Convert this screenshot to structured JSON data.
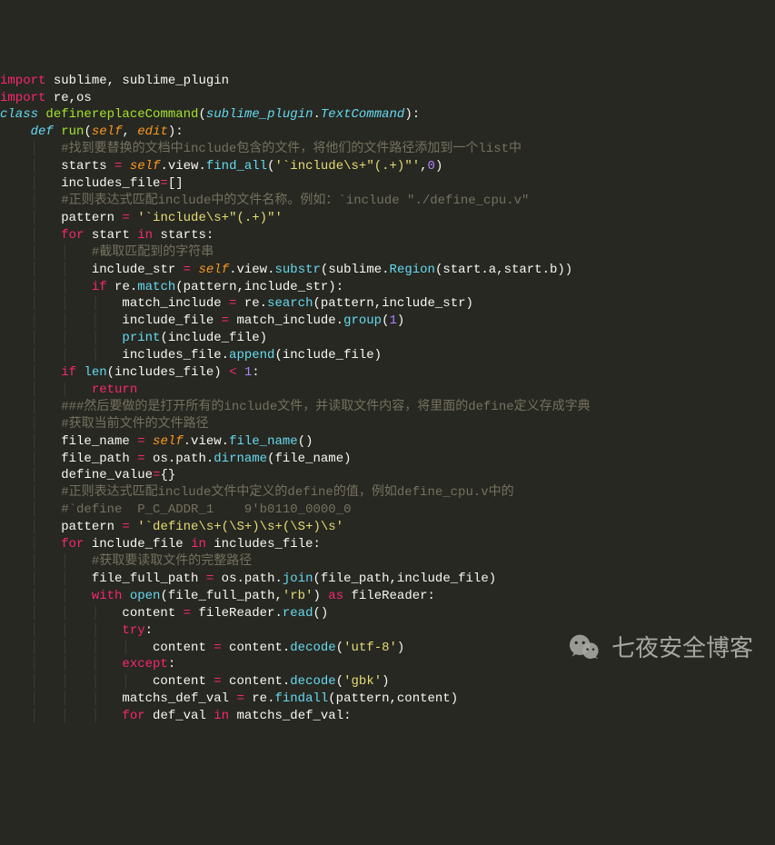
{
  "lines": [
    [
      [
        "kw-import",
        "import"
      ],
      [
        "plain",
        " sublime, sublime_plugin"
      ]
    ],
    [
      [
        "kw-import",
        "import"
      ],
      [
        "plain",
        " re,os"
      ]
    ],
    [
      [
        "plain",
        ""
      ]
    ],
    [
      [
        "kw-class",
        "class"
      ],
      [
        "plain",
        " "
      ],
      [
        "cls-name",
        "definereplaceCommand"
      ],
      [
        "plain",
        "("
      ],
      [
        "type",
        "sublime_plugin"
      ],
      [
        "plain",
        "."
      ],
      [
        "type",
        "TextCommand"
      ],
      [
        "plain",
        "):"
      ]
    ],
    [
      [
        "plain",
        "    "
      ],
      [
        "kw-def",
        "def"
      ],
      [
        "plain",
        " "
      ],
      [
        "fn-name",
        "run"
      ],
      [
        "plain",
        "("
      ],
      [
        "param",
        "self"
      ],
      [
        "plain",
        ", "
      ],
      [
        "param",
        "edit"
      ],
      [
        "plain",
        "):"
      ]
    ],
    [
      [
        "guide",
        "    │   "
      ],
      [
        "comment",
        "#找到要替换的文档中include包含的文件，将他们的文件路径添加到一个list中"
      ]
    ],
    [
      [
        "guide",
        "    │   "
      ],
      [
        "plain",
        "starts "
      ],
      [
        "kw-op",
        "="
      ],
      [
        "plain",
        " "
      ],
      [
        "self",
        "self"
      ],
      [
        "plain",
        ".view."
      ],
      [
        "fn-call",
        "find_all"
      ],
      [
        "plain",
        "("
      ],
      [
        "str",
        "'`include\\s+\"(.+)\"'"
      ],
      [
        "plain",
        ","
      ],
      [
        "num",
        "0"
      ],
      [
        "plain",
        ")"
      ]
    ],
    [
      [
        "guide",
        "    │   "
      ],
      [
        "plain",
        "includes_file"
      ],
      [
        "kw-op",
        "="
      ],
      [
        "plain",
        "[]"
      ]
    ],
    [
      [
        "guide",
        "    │   "
      ],
      [
        "comment",
        "#正则表达式匹配include中的文件名称。例如：`include \"./define_cpu.v\""
      ]
    ],
    [
      [
        "guide",
        "    │   "
      ],
      [
        "plain",
        "pattern "
      ],
      [
        "kw-op",
        "="
      ],
      [
        "plain",
        " "
      ],
      [
        "str",
        "'`include\\s+\"(.+)\"'"
      ]
    ],
    [
      [
        "guide",
        "    │   "
      ],
      [
        "kw-flow",
        "for"
      ],
      [
        "plain",
        " start "
      ],
      [
        "kw-flow",
        "in"
      ],
      [
        "plain",
        " starts:"
      ]
    ],
    [
      [
        "guide",
        "    │   │   "
      ],
      [
        "comment",
        "#截取匹配到的字符串"
      ]
    ],
    [
      [
        "guide",
        "    │   │   "
      ],
      [
        "plain",
        "include_str "
      ],
      [
        "kw-op",
        "="
      ],
      [
        "plain",
        " "
      ],
      [
        "self",
        "self"
      ],
      [
        "plain",
        ".view."
      ],
      [
        "fn-call",
        "substr"
      ],
      [
        "plain",
        "(sublime."
      ],
      [
        "fn-call",
        "Region"
      ],
      [
        "plain",
        "(start.a,start.b))"
      ]
    ],
    [
      [
        "guide",
        "    │   │   "
      ],
      [
        "kw-flow",
        "if"
      ],
      [
        "plain",
        " re."
      ],
      [
        "fn-call",
        "match"
      ],
      [
        "plain",
        "(pattern,include_str):"
      ]
    ],
    [
      [
        "guide",
        "    │   │   │   "
      ],
      [
        "plain",
        "match_include "
      ],
      [
        "kw-op",
        "="
      ],
      [
        "plain",
        " re."
      ],
      [
        "fn-call",
        "search"
      ],
      [
        "plain",
        "(pattern,include_str)"
      ]
    ],
    [
      [
        "guide",
        "    │   │   │   "
      ],
      [
        "plain",
        "include_file "
      ],
      [
        "kw-op",
        "="
      ],
      [
        "plain",
        " match_include."
      ],
      [
        "fn-call",
        "group"
      ],
      [
        "plain",
        "("
      ],
      [
        "num",
        "1"
      ],
      [
        "plain",
        ")"
      ]
    ],
    [
      [
        "guide",
        "    │   │   │   "
      ],
      [
        "fn-call",
        "print"
      ],
      [
        "plain",
        "(include_file)"
      ]
    ],
    [
      [
        "guide",
        "    │   │   │   "
      ],
      [
        "plain",
        "includes_file."
      ],
      [
        "fn-call",
        "append"
      ],
      [
        "plain",
        "(include_file)"
      ]
    ],
    [
      [
        "guide",
        "    │   "
      ],
      [
        "kw-flow",
        "if"
      ],
      [
        "plain",
        " "
      ],
      [
        "fn-call",
        "len"
      ],
      [
        "plain",
        "(includes_file) "
      ],
      [
        "kw-op",
        "<"
      ],
      [
        "plain",
        " "
      ],
      [
        "num",
        "1"
      ],
      [
        "plain",
        ":"
      ]
    ],
    [
      [
        "guide",
        "    │   │   "
      ],
      [
        "kw-flow",
        "return"
      ]
    ],
    [
      [
        "guide",
        "    │   "
      ],
      [
        "comment",
        "###然后要做的是打开所有的include文件，并读取文件内容，将里面的define定义存成字典"
      ]
    ],
    [
      [
        "guide",
        "    │   "
      ],
      [
        "comment",
        "#获取当前文件的文件路径"
      ]
    ],
    [
      [
        "guide",
        "    │   "
      ],
      [
        "plain",
        "file_name "
      ],
      [
        "kw-op",
        "="
      ],
      [
        "plain",
        " "
      ],
      [
        "self",
        "self"
      ],
      [
        "plain",
        ".view."
      ],
      [
        "fn-call",
        "file_name"
      ],
      [
        "plain",
        "()"
      ]
    ],
    [
      [
        "guide",
        "    │   "
      ],
      [
        "plain",
        "file_path "
      ],
      [
        "kw-op",
        "="
      ],
      [
        "plain",
        " os.path."
      ],
      [
        "fn-call",
        "dirname"
      ],
      [
        "plain",
        "(file_name)"
      ]
    ],
    [
      [
        "guide",
        "    │   "
      ],
      [
        "plain",
        "define_value"
      ],
      [
        "kw-op",
        "="
      ],
      [
        "plain",
        "{}"
      ]
    ],
    [
      [
        "guide",
        "    │   "
      ],
      [
        "comment",
        "#正则表达式匹配include文件中定义的define的值，例如define_cpu.v中的"
      ]
    ],
    [
      [
        "guide",
        "    │   "
      ],
      [
        "comment",
        "#`define  P_C_ADDR_1    9'b0110_0000_0"
      ]
    ],
    [
      [
        "guide",
        "    │   "
      ],
      [
        "plain",
        "pattern "
      ],
      [
        "kw-op",
        "="
      ],
      [
        "plain",
        " "
      ],
      [
        "str",
        "'`define\\s+(\\S+)\\s+(\\S+)\\s'"
      ]
    ],
    [
      [
        "guide",
        "    │   "
      ],
      [
        "kw-flow",
        "for"
      ],
      [
        "plain",
        " include_file "
      ],
      [
        "kw-flow",
        "in"
      ],
      [
        "plain",
        " includes_file:"
      ]
    ],
    [
      [
        "guide",
        "    │   │   "
      ],
      [
        "comment",
        "#获取要读取文件的完整路径"
      ]
    ],
    [
      [
        "guide",
        "    │   │   "
      ],
      [
        "plain",
        "file_full_path "
      ],
      [
        "kw-op",
        "="
      ],
      [
        "plain",
        " os.path."
      ],
      [
        "fn-call",
        "join"
      ],
      [
        "plain",
        "(file_path,include_file)"
      ]
    ],
    [
      [
        "guide",
        "    │   │   "
      ],
      [
        "kw-flow",
        "with"
      ],
      [
        "plain",
        " "
      ],
      [
        "fn-call",
        "open"
      ],
      [
        "plain",
        "(file_full_path,"
      ],
      [
        "str",
        "'rb'"
      ],
      [
        "plain",
        ") "
      ],
      [
        "kw-flow",
        "as"
      ],
      [
        "plain",
        " fileReader:"
      ]
    ],
    [
      [
        "guide",
        "    │   │   │   "
      ],
      [
        "plain",
        "content "
      ],
      [
        "kw-op",
        "="
      ],
      [
        "plain",
        " fileReader."
      ],
      [
        "fn-call",
        "read"
      ],
      [
        "plain",
        "()"
      ]
    ],
    [
      [
        "guide",
        "    │   │   │   "
      ],
      [
        "kw-flow",
        "try"
      ],
      [
        "plain",
        ":"
      ]
    ],
    [
      [
        "guide",
        "    │   │   │   │   "
      ],
      [
        "plain",
        "content "
      ],
      [
        "kw-op",
        "="
      ],
      [
        "plain",
        " content."
      ],
      [
        "fn-call",
        "decode"
      ],
      [
        "plain",
        "("
      ],
      [
        "str",
        "'utf-8'"
      ],
      [
        "plain",
        ")"
      ]
    ],
    [
      [
        "guide",
        "    │   │   │   "
      ],
      [
        "kw-flow",
        "except"
      ],
      [
        "plain",
        ":"
      ]
    ],
    [
      [
        "guide",
        "    │   │   │   │   "
      ],
      [
        "plain",
        "content "
      ],
      [
        "kw-op",
        "="
      ],
      [
        "plain",
        " content."
      ],
      [
        "fn-call",
        "decode"
      ],
      [
        "plain",
        "("
      ],
      [
        "str",
        "'gbk'"
      ],
      [
        "plain",
        ")"
      ]
    ],
    [
      [
        "plain",
        ""
      ]
    ],
    [
      [
        "guide",
        "    │   │   │   "
      ],
      [
        "plain",
        "matchs_def_val "
      ],
      [
        "kw-op",
        "="
      ],
      [
        "plain",
        " re."
      ],
      [
        "fn-call",
        "findall"
      ],
      [
        "plain",
        "(pattern,content)"
      ]
    ],
    [
      [
        "guide",
        "    │   │   │   "
      ],
      [
        "kw-flow",
        "for"
      ],
      [
        "plain",
        " def_val "
      ],
      [
        "kw-flow",
        "in"
      ],
      [
        "plain",
        " matchs_def_val:"
      ]
    ]
  ],
  "watermark_text": "七夜安全博客"
}
